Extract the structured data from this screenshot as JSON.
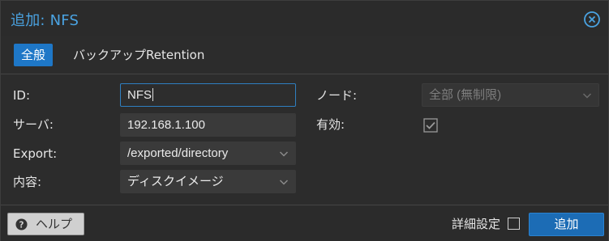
{
  "dialog": {
    "title": "追加: NFS",
    "close_icon": "close-circle-icon"
  },
  "tabs": [
    {
      "label": "全般",
      "active": true
    },
    {
      "label": "バックアップRetention",
      "active": false
    }
  ],
  "form": {
    "id": {
      "label": "ID:",
      "value": "NFS"
    },
    "server": {
      "label": "サーバ:",
      "value": "192.168.1.100"
    },
    "export": {
      "label": "Export:",
      "value": "/exported/directory"
    },
    "content": {
      "label": "内容:",
      "value": "ディスクイメージ"
    },
    "node": {
      "label": "ノード:",
      "value": "全部 (無制限)"
    },
    "enabled": {
      "label": "有効:",
      "checked": true
    }
  },
  "footer": {
    "help_label": "ヘルプ",
    "help_icon": "question-circle-icon",
    "advanced_label": "詳細設定",
    "advanced_checked": false,
    "add_label": "追加"
  },
  "colors": {
    "accent": "#1e77c7",
    "title": "#4aa3e2",
    "background": "#2c2c2c"
  }
}
